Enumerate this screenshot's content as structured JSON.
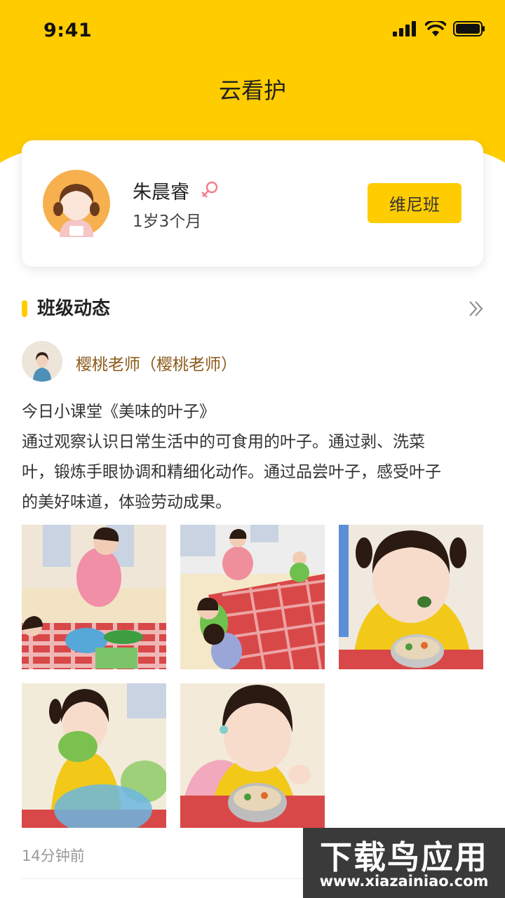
{
  "status_bar": {
    "time": "9:41"
  },
  "nav": {
    "title": "云看护"
  },
  "profile": {
    "name": "朱晨睿",
    "gender": "female",
    "age": "1岁3个月",
    "class_label": "维尼班"
  },
  "section": {
    "title": "班级动态"
  },
  "post": {
    "teacher": "樱桃老师（樱桃老师）",
    "lines": [
      "今日小课堂《美味的叶子》",
      "通过观察认识日常生活中的可食用的叶子。通过剥、洗菜",
      "叶，锻炼手眼协调和精细化动作。通过品尝叶子，感受叶子",
      "的美好味道，体验劳动成果。"
    ],
    "time": "14分钟前"
  },
  "watermark": {
    "title": "下载鸟应用",
    "url": "www.xiazainiao.com"
  },
  "colors": {
    "brand_yellow": "#FFCC00",
    "teacher_name": "#8B5A1A"
  }
}
